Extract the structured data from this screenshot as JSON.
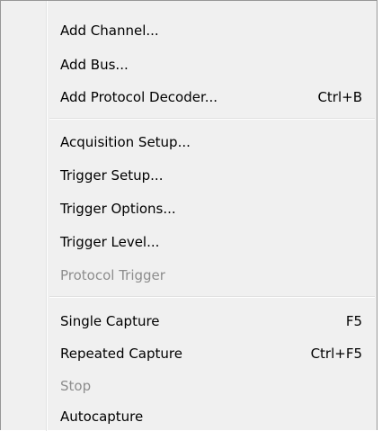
{
  "menu": {
    "items": [
      {
        "label": "Add Channel...",
        "shortcut": ""
      },
      {
        "label": "Add Bus...",
        "shortcut": ""
      },
      {
        "label": "Add Protocol Decoder...",
        "shortcut": "Ctrl+B"
      },
      {
        "label": "Acquisition Setup...",
        "shortcut": ""
      },
      {
        "label": "Trigger Setup...",
        "shortcut": ""
      },
      {
        "label": "Trigger Options...",
        "shortcut": ""
      },
      {
        "label": "Trigger Level...",
        "shortcut": ""
      },
      {
        "label": "Protocol Trigger",
        "shortcut": ""
      },
      {
        "label": "Single Capture",
        "shortcut": "F5"
      },
      {
        "label": "Repeated Capture",
        "shortcut": "Ctrl+F5"
      },
      {
        "label": "Stop",
        "shortcut": ""
      },
      {
        "label": "Autocapture",
        "shortcut": ""
      }
    ]
  },
  "colors": {
    "menu_background": "#f0f0f0",
    "text": "#000000",
    "disabled_text": "#8d8d8d",
    "border": "#979797"
  }
}
